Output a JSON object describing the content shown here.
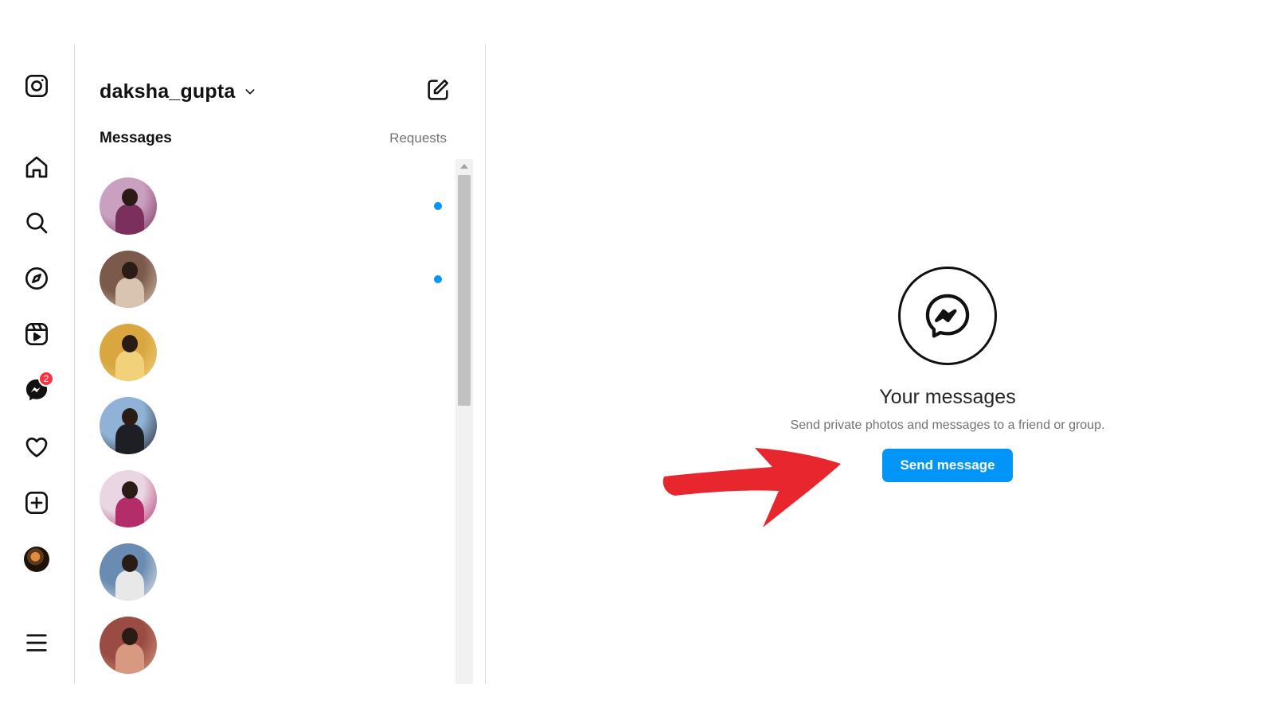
{
  "sidebar": {
    "items": [
      {
        "icon": "instagram-logo-icon",
        "label": ""
      },
      {
        "icon": "home-icon"
      },
      {
        "icon": "search-icon"
      },
      {
        "icon": "explore-compass-icon"
      },
      {
        "icon": "reels-icon"
      },
      {
        "icon": "messenger-icon",
        "badge": "2"
      },
      {
        "icon": "heart-icon"
      },
      {
        "icon": "create-plus-icon"
      },
      {
        "icon": "profile-avatar"
      },
      {
        "icon": "hamburger-menu-icon"
      }
    ]
  },
  "inbox": {
    "username": "daksha_gupta",
    "tabs": {
      "messages": "Messages",
      "requests": "Requests"
    },
    "conversations": [
      {
        "unread": true,
        "palette": [
          "#caa0c0",
          "#7a2f5c"
        ]
      },
      {
        "unread": true,
        "palette": [
          "#7b5a4c",
          "#d8c4b0"
        ]
      },
      {
        "unread": false,
        "palette": [
          "#d9a640",
          "#f2d17b"
        ]
      },
      {
        "unread": false,
        "palette": [
          "#8fb2d6",
          "#1e1e25"
        ]
      },
      {
        "unread": false,
        "palette": [
          "#e9d6e2",
          "#b32d6b"
        ]
      },
      {
        "unread": false,
        "palette": [
          "#6a8cb3",
          "#e8e8e8"
        ]
      },
      {
        "unread": false,
        "palette": [
          "#9a4b43",
          "#d79a80"
        ]
      }
    ]
  },
  "empty_state": {
    "title": "Your messages",
    "subtitle": "Send private photos and messages to a friend or group.",
    "button_label": "Send message"
  },
  "colors": {
    "accent": "#0095f6",
    "badge": "#ff3040",
    "annotation_arrow": "#e8262d"
  }
}
